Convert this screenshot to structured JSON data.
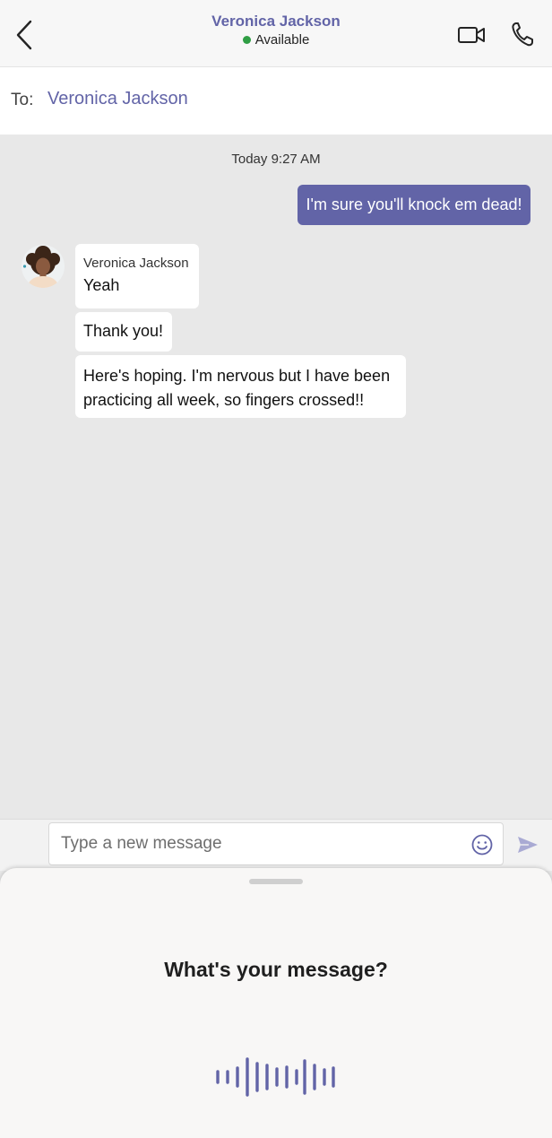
{
  "header": {
    "contact_name": "Veronica Jackson",
    "status": "Available",
    "status_color": "#2f9e44",
    "back_icon": "chevron-left-icon",
    "video_icon": "video-camera-icon",
    "call_icon": "phone-icon"
  },
  "to_bar": {
    "label": "To:",
    "recipient": "Veronica Jackson"
  },
  "chat": {
    "timestamp": "Today 9:27 AM",
    "sent_message": "I'm sure you'll knock em dead!",
    "sender_name": "Veronica Jackson",
    "received": [
      "Yeah",
      "Thank you!",
      "Here's hoping. I'm nervous but I have been practicing all week, so fingers crossed!!"
    ]
  },
  "composer": {
    "placeholder": "Type a new message",
    "emoji_icon": "smiley-icon",
    "send_icon": "send-icon"
  },
  "voice_sheet": {
    "prompt": "What's your message?",
    "wave_icon": "voice-waveform-icon"
  },
  "colors": {
    "accent": "#6264a7",
    "chat_bg": "#e8e8e8",
    "bubble_received": "#ffffff"
  }
}
